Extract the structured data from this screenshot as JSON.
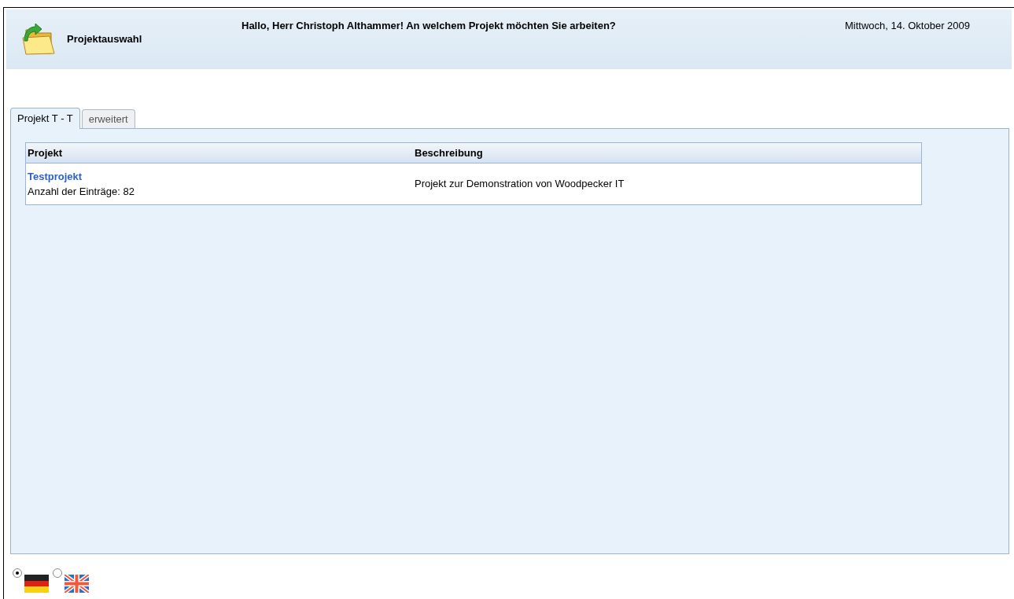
{
  "header": {
    "title": "Projektauswahl",
    "greeting": "Hallo, Herr Christoph Althammer! An welchem Projekt möchten Sie arbeiten?",
    "date": "Mittwoch, 14. Oktober 2009"
  },
  "tabs": [
    {
      "label": "Projekt T - T",
      "selected": true
    },
    {
      "label": "erweitert",
      "selected": false
    }
  ],
  "table": {
    "columns": [
      "Projekt",
      "Beschreibung"
    ],
    "rows": [
      {
        "name": "Testprojekt",
        "entries": "Anzahl der Einträge: 82",
        "description": "Projekt zur Demonstration von Woodpecker IT"
      }
    ]
  },
  "languages": [
    {
      "kind": "de",
      "selected": true
    },
    {
      "kind": "en",
      "selected": false
    }
  ]
}
